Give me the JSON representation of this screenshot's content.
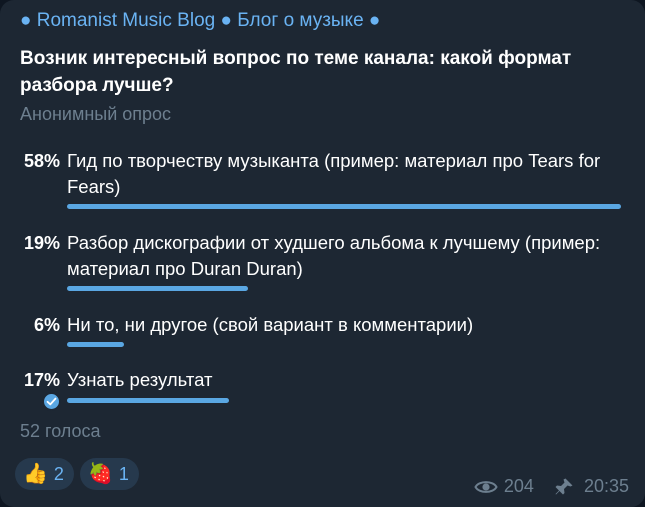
{
  "post": {
    "channel_title": "● Romanist Music Blog ● Блог о музыке ●",
    "question": "Возник интересный вопрос по теме канала: какой формат разбора лучше?",
    "poll_type": "Анонимный опрос",
    "options": [
      {
        "percent": "58%",
        "text": "Гид по творчеству музыканта (пример: материал про Tears for Fears)",
        "share": 0.58
      },
      {
        "percent": "19%",
        "text": "Разбор дискографии от худшего альбома к лучшему (пример: материал про Duran Duran)",
        "share": 0.19
      },
      {
        "percent": "6%",
        "text": "Ни то, ни другое (свой вариант в комментарии)",
        "share": 0.06
      },
      {
        "percent": "17%",
        "text": "Узнать результат",
        "share": 0.17,
        "selected": true
      }
    ],
    "votes": "52 голоса",
    "reactions": [
      {
        "emoji": "👍",
        "count": "2",
        "icon": "thumbs-up-icon"
      },
      {
        "emoji": "🍓",
        "count": "1",
        "icon": "strawberry-icon"
      }
    ],
    "views": "204",
    "time": "20:35"
  },
  "colors": {
    "accent": "#5aa7e3",
    "link": "#6ab3f3",
    "muted": "#6d7f8f",
    "bubble": "#1d2733",
    "background": "#0e1621"
  }
}
